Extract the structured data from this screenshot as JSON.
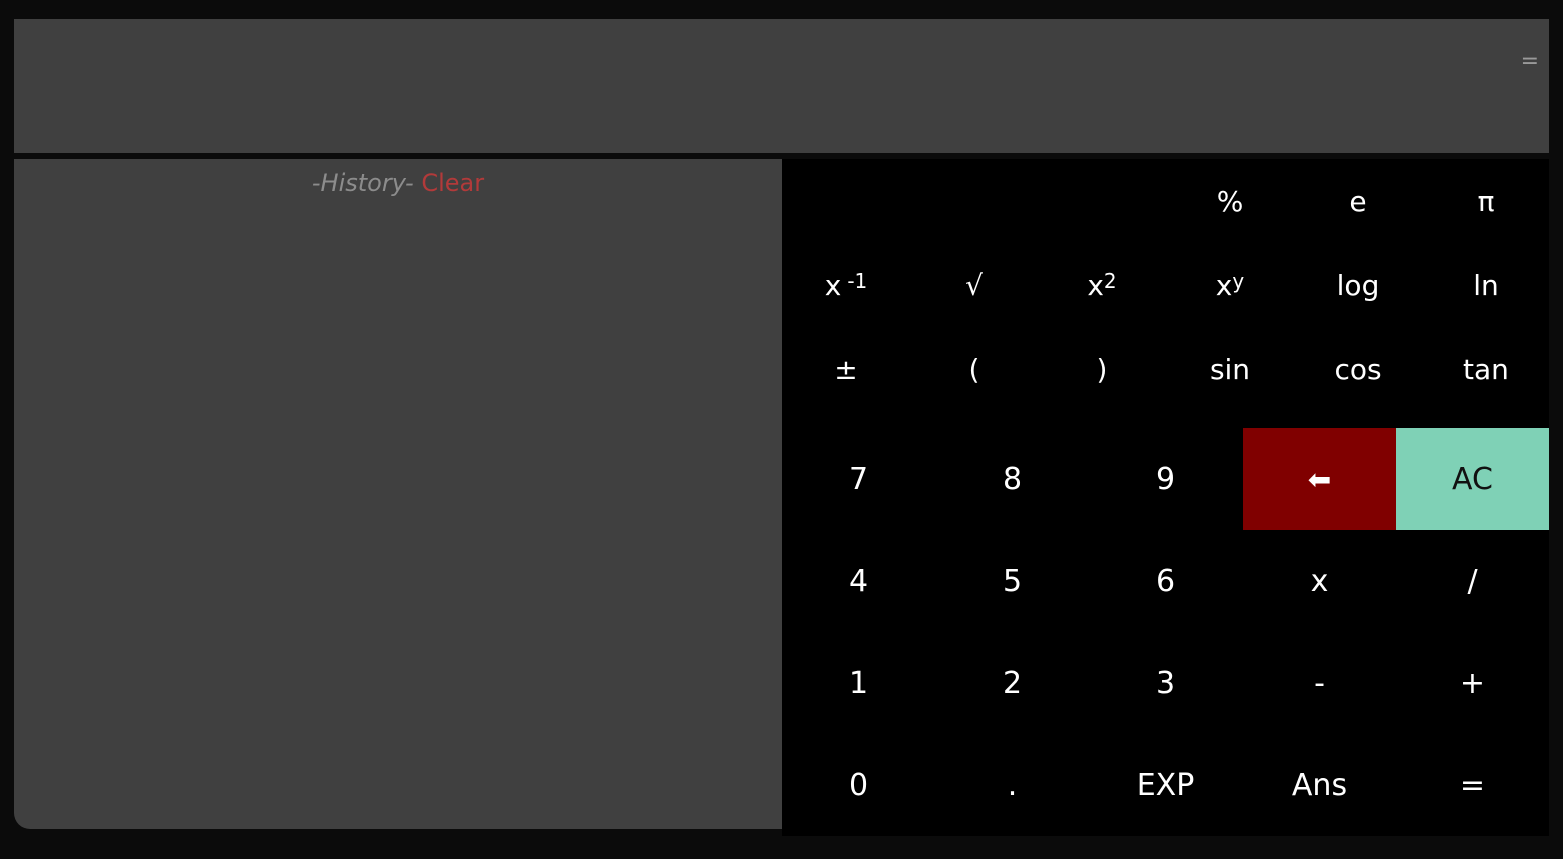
{
  "display": {
    "equals_mark": "="
  },
  "history": {
    "title": "-History-",
    "clear_label": "Clear"
  },
  "keypad": {
    "row1": {
      "percent": "%",
      "e": "e",
      "pi": "π"
    },
    "row2": {
      "inverse_base": "x",
      "inverse_exp": "-1",
      "sqrt": "√",
      "square_base": "x",
      "square_exp": "2",
      "power_base": "x",
      "power_exp": "y",
      "log": "log",
      "ln": "ln"
    },
    "row3": {
      "plus_minus": "±",
      "open_paren": "(",
      "close_paren": ")",
      "sin": "sin",
      "cos": "cos",
      "tan": "tan"
    },
    "row4": {
      "seven": "7",
      "eight": "8",
      "nine": "9",
      "backspace": "⬅",
      "ac": "AC"
    },
    "row5": {
      "four": "4",
      "five": "5",
      "six": "6",
      "multiply": "x",
      "divide": "/"
    },
    "row6": {
      "one": "1",
      "two": "2",
      "three": "3",
      "minus": "-",
      "plus": "+"
    },
    "row7": {
      "zero": "0",
      "dot": ".",
      "exp": "EXP",
      "ans": "Ans",
      "equals": "="
    }
  },
  "colors": {
    "background": "#0b0b0b",
    "panel": "#404040",
    "keypad": "#000000",
    "backspace": "#800000",
    "ac": "#7fd1b6",
    "clear_link": "#b23a3a"
  }
}
